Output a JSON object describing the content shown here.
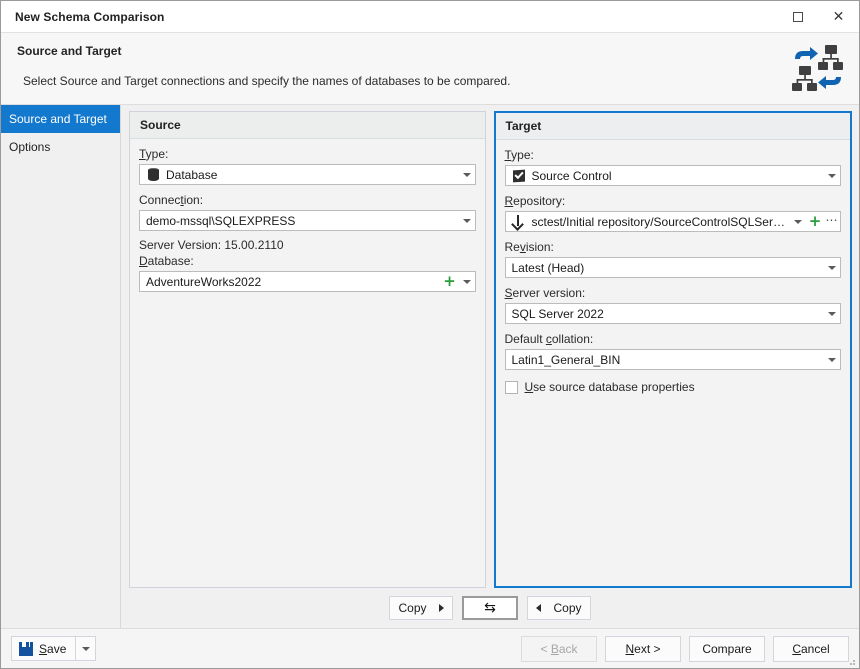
{
  "window": {
    "title": "New Schema Comparison",
    "maximize_icon": "maximize-icon",
    "close_icon": "close-icon"
  },
  "header": {
    "title": "Source and Target",
    "description": "Select Source and Target connections and specify the names of databases to be compared.",
    "logo_icon": "schema-compare-logo-icon"
  },
  "sidebar": {
    "items": [
      {
        "label": "Source and Target",
        "selected": true
      },
      {
        "label": "Options",
        "selected": false
      }
    ]
  },
  "source_panel": {
    "title": "Source",
    "type_label": "Type:",
    "type_value": "Database",
    "type_icon": "database-icon",
    "connection_label": "Connection:",
    "connection_value": "demo-mssql\\SQLEXPRESS",
    "server_version_line": "Server Version: 15.00.2110",
    "database_label": "Database:",
    "database_value": "AdventureWorks2022",
    "add_icon": "plus-icon",
    "dropdown_icon": "chevron-down-icon"
  },
  "target_panel": {
    "title": "Target",
    "type_label": "Type:",
    "type_value": "Source Control",
    "type_icon": "source-control-icon",
    "repository_label": "Repository:",
    "repository_value": "sctest/Initial repository/SourceControlSQLServer (Sour...",
    "repository_icon": "branch-icon",
    "add_icon": "plus-icon",
    "more_icon": "ellipsis-icon",
    "revision_label": "Revision:",
    "revision_value": "Latest (Head)",
    "server_version_label": "Server version:",
    "server_version_value": "SQL Server 2022",
    "collation_label": "Default collation:",
    "collation_value": "Latin1_General_BIN",
    "use_source_props_label": "Use source database properties",
    "use_source_props_checked": false
  },
  "copy_strip": {
    "copy_right_label": "Copy",
    "copy_right_icon": "arrow-right-icon",
    "swap_label": "",
    "swap_icon": "swap-arrows-icon",
    "copy_left_label": "Copy",
    "copy_left_icon": "arrow-left-icon"
  },
  "footer": {
    "save_label": "Save",
    "save_icon": "save-floppy-icon",
    "save_caret_icon": "chevron-down-icon",
    "back_label": "< Back",
    "back_disabled": true,
    "next_label": "Next >",
    "compare_label": "Compare",
    "cancel_label": "Cancel"
  },
  "colors": {
    "accent": "#1379ce",
    "selection": "#1379ce",
    "plus_green": "#2a9c3a",
    "save_blue": "#14529f"
  }
}
